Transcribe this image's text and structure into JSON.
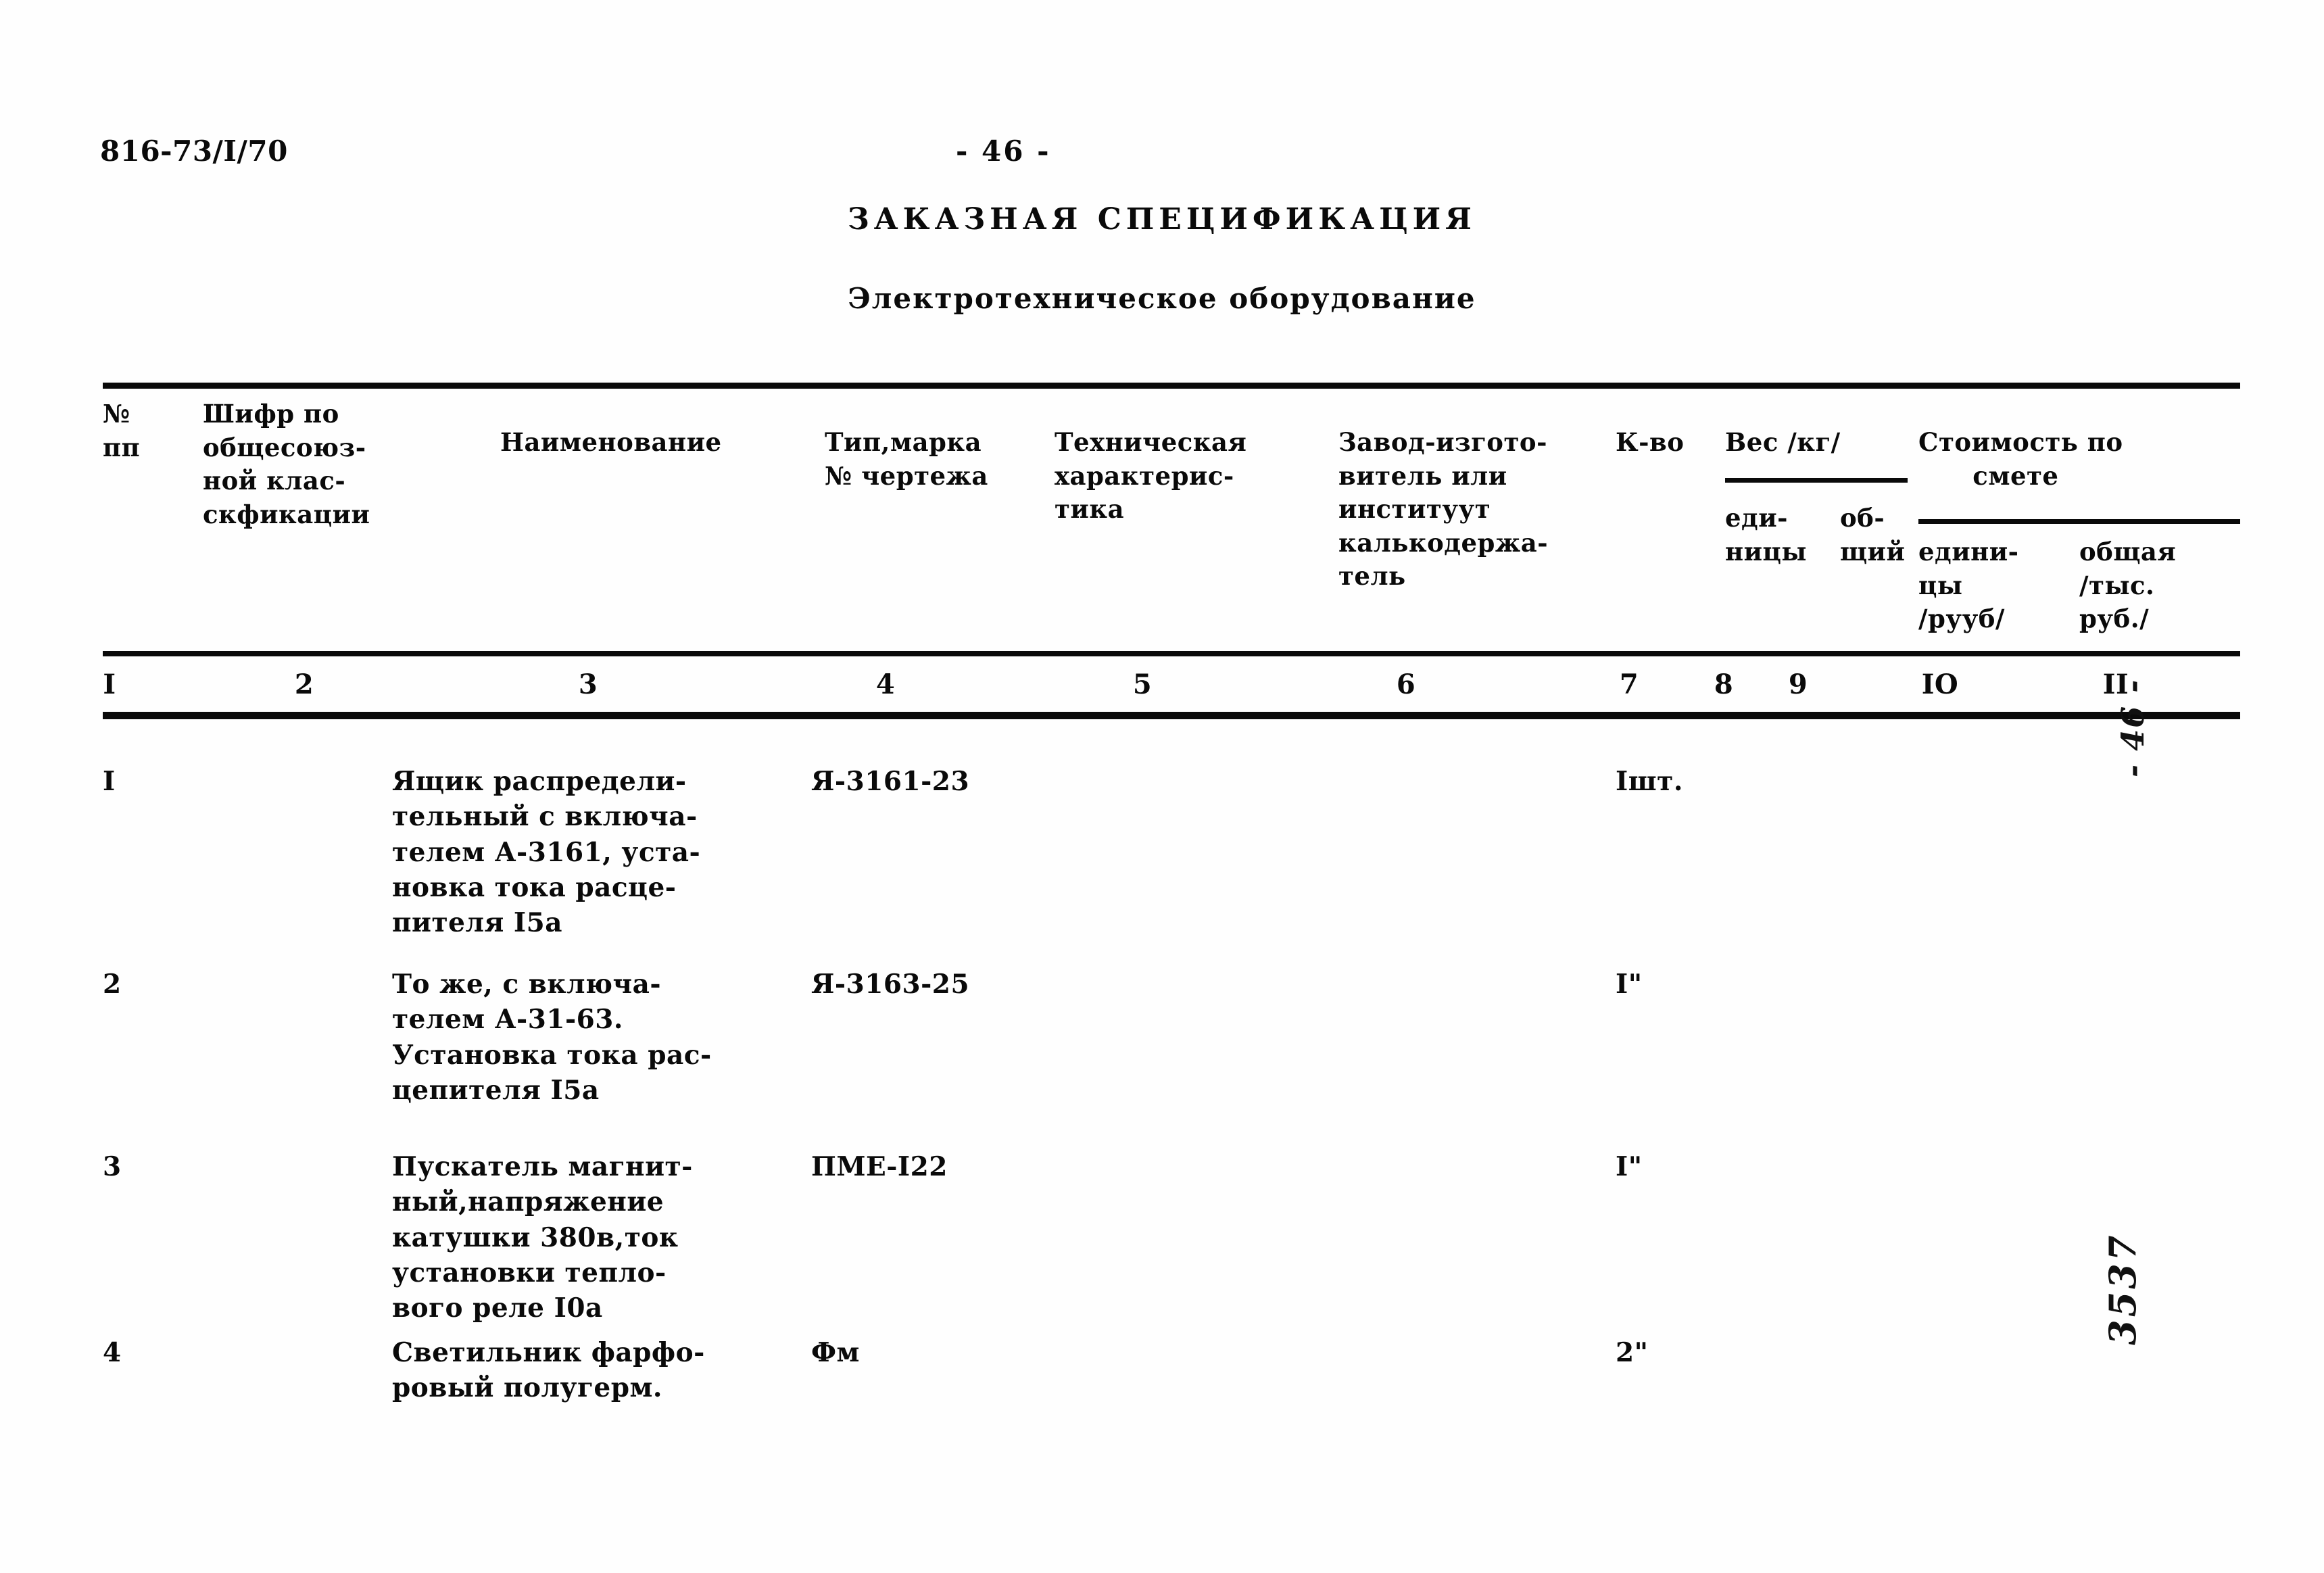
{
  "document": {
    "code": "816-73/I/70",
    "page_marker": "- 46 -",
    "title": "ЗАКАЗНАЯ СПЕЦИФИКАЦИЯ",
    "subtitle": "Электротехническое оборудование"
  },
  "margin_notes": {
    "page_handwritten": "- 46 -",
    "archive_handwritten": "3537"
  },
  "table": {
    "headers": {
      "no": "№\nпп",
      "cipher": "Шифр по\nобщесоюз-\nной клас-\nскфикации",
      "name": "Наименование",
      "type": "Тип,марка\n№ чертежа",
      "tech": "Техническая\nхарактерис-\nтика",
      "factory": "Завод-изгото-\nвитель или\nинституут\nкалькодержа-\nтель",
      "qty": "К-во",
      "weight": "Вес /кг/",
      "weight_unit": "еди-\nницы",
      "weight_total": "об-\nщий",
      "cost": "Стоимость по\n      смете",
      "cost_unit": "едини-\nцы\n/рууб/",
      "cost_total": "общая\n/тыс.\nруб./"
    },
    "column_numbers": [
      "I",
      "2",
      "3",
      "4",
      "5",
      "6",
      "7",
      "8",
      "9",
      "IO",
      "II"
    ],
    "rows": [
      {
        "no": "I",
        "cipher": "",
        "name": "Ящик распредели-\nтельный с включа-\nтелем А-3161, уста-\nновка тока расце-\nпителя I5а",
        "type": "Я-3161-23",
        "tech": "",
        "factory": "",
        "qty": "Iшт.",
        "weight_unit": "",
        "weight_total": "",
        "cost_unit": "",
        "cost_total": ""
      },
      {
        "no": "2",
        "cipher": "",
        "name": "То же, с включа-\nтелем А-31-63.\nУстановка тока рас-\nцепителя I5а",
        "type": "Я-3163-25",
        "tech": "",
        "factory": "",
        "qty": "I\"",
        "weight_unit": "",
        "weight_total": "",
        "cost_unit": "",
        "cost_total": ""
      },
      {
        "no": "3",
        "cipher": "",
        "name": "Пускатель магнит-\nный,напряжение\nкатушки 380в,ток\nустановки тепло-\nвого реле I0а",
        "type": "ПМЕ-I22",
        "tech": "",
        "factory": "",
        "qty": "I\"",
        "weight_unit": "",
        "weight_total": "",
        "cost_unit": "",
        "cost_total": ""
      },
      {
        "no": "4",
        "cipher": "",
        "name": "Светильник фарфо-\nровый полугерм.",
        "type": "Фм",
        "tech": "",
        "factory": "",
        "qty": "2\"",
        "weight_unit": "",
        "weight_total": "",
        "cost_unit": "",
        "cost_total": ""
      }
    ]
  }
}
